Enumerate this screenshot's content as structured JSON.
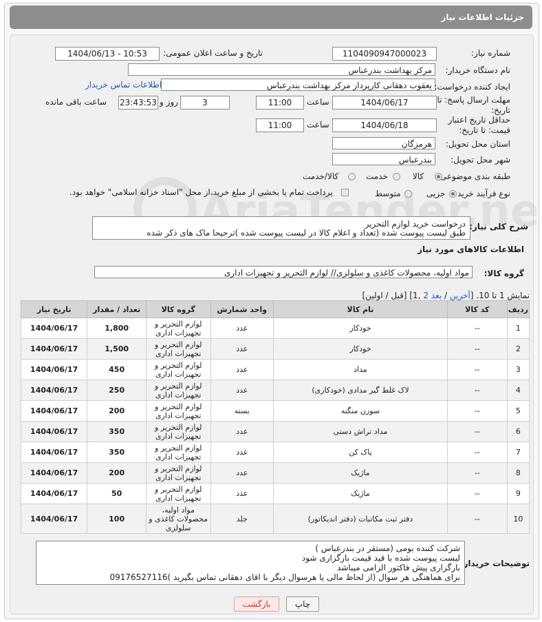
{
  "header": {
    "title": "جزئیات اطلاعات نیاز"
  },
  "form": {
    "need_number_label": "شماره نیاز:",
    "need_number": "1104090947000023",
    "announce_label": "تاریخ و ساعت اعلان عمومی:",
    "announce_value": "1404/06/13 - 10:53",
    "buyer_org_label": "نام دستگاه خریدار:",
    "buyer_org": "مرکز بهداشت بندرعباس",
    "requester_label": "ایجاد کننده درخواست:",
    "requester": "یعقوب دهقانی کارپرداز مرکز بهداشت بندرعباس",
    "contact_link": "اطلاعات تماس خریدار",
    "deadline_label": "مهلت ارسال پاسخ: تا تاریخ:",
    "deadline_date": "1404/06/17",
    "time_label": "ساعت",
    "deadline_time": "11:00",
    "days_value": "3",
    "days_label": "روز و",
    "remaining_value": "23:43:53",
    "remaining_label": "ساعت باقی مانده",
    "price_validity_label": "حداقل تاریخ اعتبار قیمت: تا تاریخ:",
    "price_validity_date": "1404/06/18",
    "price_validity_time": "11:00",
    "province_label": "استان محل تحویل:",
    "province": "هرمزگان",
    "city_label": "شهر محل تحویل:",
    "city": "بندرعباس",
    "category_label": "طبقه بندی موضوعی:",
    "category_options": [
      "کالا",
      "خدمت",
      "کالا/خدمت"
    ],
    "category_selected": "کالا",
    "process_label": "نوع فرآیند خرید :",
    "process_options": [
      "جزیی",
      "متوسط"
    ],
    "process_selected": "جزیی",
    "payment_note": "پرداخت تمام یا بخشی از مبلغ خرید،از محل \"اسناد خزانه اسلامی\" خواهد بود."
  },
  "description": {
    "label": "شرح کلی نیاز:",
    "lines": [
      "درخواست خرید لوازم التحریر",
      "طبق لیست پیوست شده (تعداد و اعلام کالا در لیست پیوست شده )ترجیحا ماک های ذکر شده"
    ]
  },
  "goods_info": {
    "title": "اطلاعات کالاهای مورد نیاز",
    "group_label": "گروه کالا:",
    "group_value": "مواد اولیه، محصولات کاغذی و سلولزی// لوازم التحریر و تجهیزات اداری",
    "pagination_prefix": "نمایش 1 تا 10. [",
    "pagination_last": "آخرین",
    "pagination_sep": " / ",
    "pagination_next": "بعد",
    "pagination_page2": "2",
    "pagination_rest": " ,1] [قبل / اولین]"
  },
  "table": {
    "headers": [
      "ردیف",
      "کد کالا",
      "نام کالا",
      "واحد شمارش",
      "گروه کالا",
      "تعداد / مقدار",
      "تاریخ نیاز"
    ],
    "rows": [
      {
        "row": "1",
        "code": "--",
        "name": "خودکار",
        "unit": "عدد",
        "group": "لوازم التحریر و تجهیزات اداری",
        "qty": "1,800",
        "date": "1404/06/17"
      },
      {
        "row": "2",
        "code": "--",
        "name": "خودکار",
        "unit": "عدد",
        "group": "لوازم التحریر و تجهیزات اداری",
        "qty": "1,500",
        "date": "1404/06/17"
      },
      {
        "row": "3",
        "code": "--",
        "name": "مداد",
        "unit": "عدد",
        "group": "لوازم التحریر و تجهیزات اداری",
        "qty": "450",
        "date": "1404/06/17"
      },
      {
        "row": "4",
        "code": "--",
        "name": "لاک غلط گیر مدادی (خودکاری)",
        "unit": "عدد",
        "group": "لوازم التحریر و تجهیزات اداری",
        "qty": "250",
        "date": "1404/06/17"
      },
      {
        "row": "5",
        "code": "--",
        "name": "سوزن منگنه",
        "unit": "بسته",
        "group": "لوازم التحریر و تجهیزات اداری",
        "qty": "200",
        "date": "1404/06/17"
      },
      {
        "row": "6",
        "code": "--",
        "name": "مداد تراش دستی",
        "unit": "عدد",
        "group": "لوازم التحریر و تجهیزات اداری",
        "qty": "350",
        "date": "1404/06/17"
      },
      {
        "row": "7",
        "code": "--",
        "name": "پاک کن",
        "unit": "عدد",
        "group": "لوازم التحریر و تجهیزات اداری",
        "qty": "350",
        "date": "1404/06/17"
      },
      {
        "row": "8",
        "code": "--",
        "name": "ماژیک",
        "unit": "عدد",
        "group": "لوازم التحریر و تجهیزات اداری",
        "qty": "200",
        "date": "1404/06/17"
      },
      {
        "row": "9",
        "code": "--",
        "name": "ماژیک",
        "unit": "عدد",
        "group": "لوازم التحریر و تجهیزات اداری",
        "qty": "50",
        "date": "1404/06/17"
      },
      {
        "row": "10",
        "code": "--",
        "name": "دفتر ثبت مکاتبات (دفتر اندیکاتور)",
        "unit": "جلد",
        "group": "مواد اولیه، محصولات کاغذی و سلولزی",
        "qty": "100",
        "date": "1404/06/17"
      }
    ]
  },
  "buyer_notes": {
    "label": "توضیحات خریدار:",
    "lines": [
      "شرکت کننده بومی (مستقر در بندرعباس )",
      "لیست پیوست شده با قید قیمت بارگزاری شود",
      "بارگزاری پیش فاکتور الزامی میباشد",
      "برای هماهنگی هر سوال (از لحاظ مالی یا هرسوال دیگر با اقای دهقانی تماس بگیرید )09176527116"
    ]
  },
  "buttons": {
    "print": "چاپ",
    "back": "بازگشت"
  },
  "colors": {
    "header_bg": "#8d8d8d",
    "link": "#1a5bb5",
    "back_button_text": "#c0392b",
    "back_button_bg": "#fde8e8"
  },
  "watermark": {
    "text": "AriaTender.net"
  }
}
